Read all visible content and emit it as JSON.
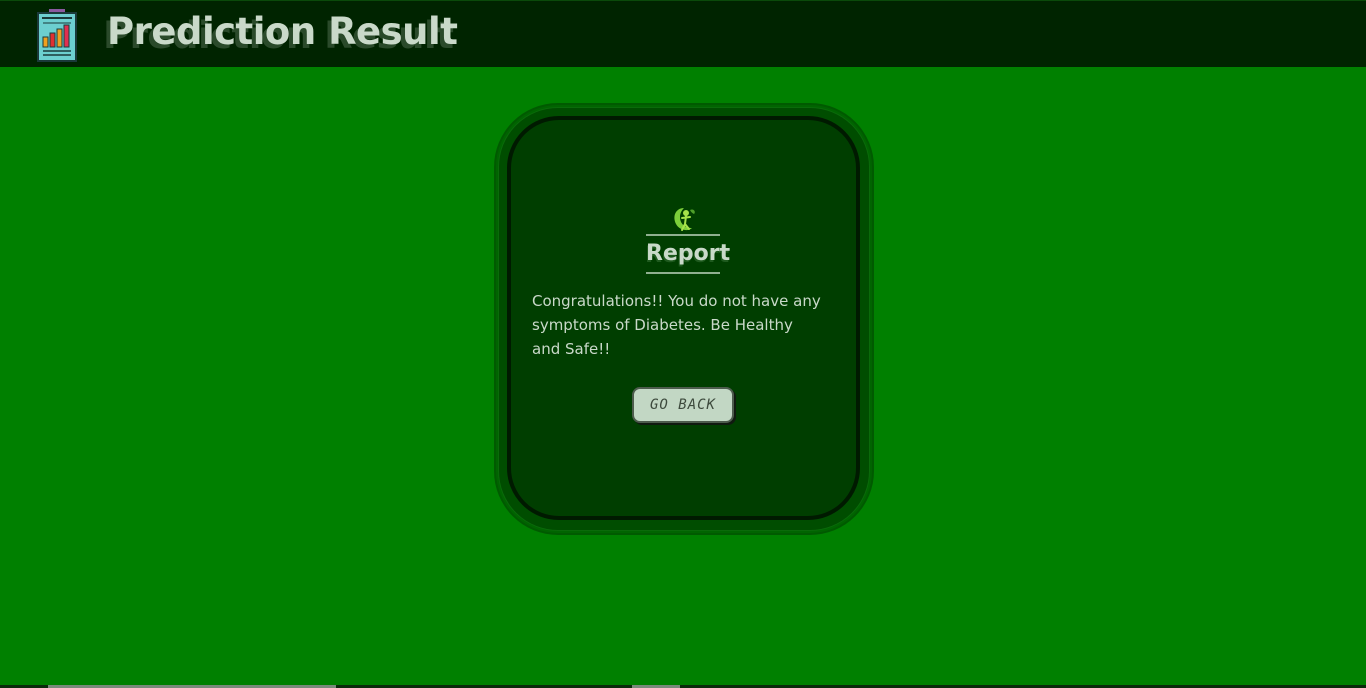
{
  "header": {
    "title": "Prediction Result",
    "logo_icon": "bar-chart-clipboard-icon"
  },
  "report": {
    "icon": "healthy-person-leaf-icon",
    "heading": "Report",
    "message": "Congratulations!! You do not have any symptoms of Diabetes. Be Healthy and Safe!!",
    "button_label": "GO BACK"
  },
  "colors": {
    "page_background": "#008000",
    "header_background": "#002400",
    "card_background": "#003e00",
    "text": "#c9d9c9",
    "button_background": "#c2d7c4"
  }
}
